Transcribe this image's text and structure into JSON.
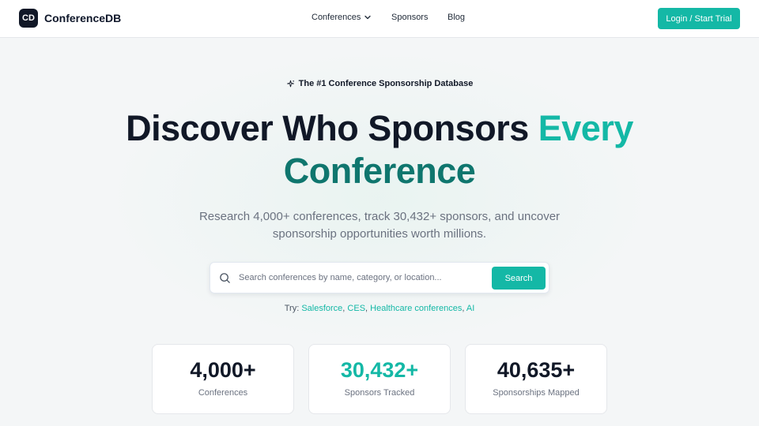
{
  "header": {
    "logo_mark": "CD",
    "logo_text": "ConferenceDB",
    "nav": {
      "conferences": "Conferences",
      "sponsors": "Sponsors",
      "blog": "Blog"
    },
    "login_label": "Login / Start Trial"
  },
  "hero": {
    "badge": "The #1 Conference Sponsorship Database",
    "headline_part1": "Discover Who Sponsors ",
    "headline_accent1": "Every",
    "headline_accent2": "Conference",
    "subtitle": "Research 4,000+ conferences, track 30,432+ sponsors, and uncover sponsorship opportunities worth millions."
  },
  "search": {
    "placeholder": "Search conferences by name, category, or location...",
    "value": "",
    "button_label": "Search"
  },
  "try": {
    "prefix": "Try:",
    "links": [
      "Salesforce",
      "CES",
      "Healthcare conferences",
      "AI"
    ]
  },
  "stats": [
    {
      "value": "4,000+",
      "label": "Conferences"
    },
    {
      "value": "30,432+",
      "label": "Sponsors Tracked"
    },
    {
      "value": "40,635+",
      "label": "Sponsorships Mapped"
    }
  ],
  "colors": {
    "accent": "#14b8a6",
    "accent_dark": "#0f766e",
    "text_dark": "#111827"
  },
  "icons": [
    "sparkle-icon",
    "chevron-down-icon",
    "search-icon"
  ]
}
